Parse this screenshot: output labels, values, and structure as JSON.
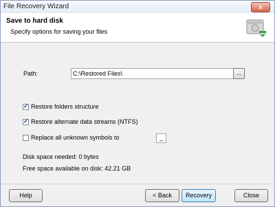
{
  "window": {
    "title": "File Recovery Wizard",
    "close_glyph": "x"
  },
  "header": {
    "title": "Save to hard disk",
    "subtitle": "Specify options for saving your files",
    "icon": "hard-disk-restore-icon"
  },
  "path": {
    "label": "Path:",
    "value": "C:\\Restored Files\\",
    "browse_label": "..."
  },
  "options": [
    {
      "label": "Restore folders structure",
      "checked": true
    },
    {
      "label": "Restore alternate data streams (NTFS)",
      "checked": true
    },
    {
      "label": "Replace all unknown symbols to",
      "checked": false
    }
  ],
  "replace_symbol": "_",
  "disk": {
    "needed": "Disk space needed: 0 bytes",
    "free": "Free space available on disk: 42.21 GB"
  },
  "buttons": {
    "help": "Help",
    "back": "< Back",
    "recovery": "Recovery",
    "close": "Close"
  },
  "colors": {
    "accent": "#3c7fb1",
    "arrow": "#3aa14a"
  }
}
